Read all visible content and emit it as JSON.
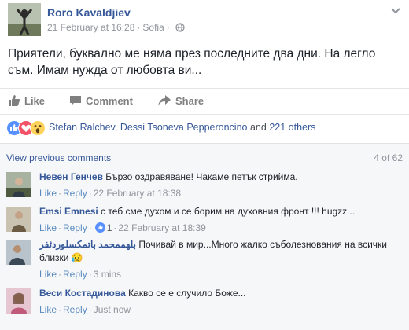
{
  "post": {
    "author": "Roro Kavaldjiev",
    "date": "21 February at 16:28",
    "location": "Sofia",
    "text": "Приятели, буквално ме няма през последните два дни. На легло съм. Имам нужда от любовта ви..."
  },
  "actions": {
    "like": "Like",
    "comment": "Comment",
    "share": "Share"
  },
  "reactions": {
    "icons": [
      "like",
      "love",
      "wow"
    ],
    "names": [
      "Stefan Ralchev",
      "Dessi Tsoneva Pepperoncino"
    ],
    "sep": ", ",
    "and_text": " and ",
    "others": "221 others"
  },
  "comments_header": {
    "view_previous": "View previous comments",
    "count": "4 of 62"
  },
  "comments": [
    {
      "author": "Невен Генчев",
      "text": "Бързо оздравяване! Чакаме петък стрийма.",
      "like": "Like",
      "reply": "Reply",
      "time": "22 February at 18:38",
      "reaction_count": ""
    },
    {
      "author": "Emsi Emnesi",
      "text": "с теб сме духом и се борим на духовния фронт !!! hugzz...",
      "like": "Like",
      "reply": "Reply",
      "time": "22 February at 18:39",
      "reaction_count": "1"
    },
    {
      "author": "بلهممحمد باتمكسلوردئفر",
      "text": "Почивай в мир...Много жалко съболезнования на всички близки 😥",
      "like": "Like",
      "reply": "Reply",
      "time": "3 mins",
      "reaction_count": ""
    },
    {
      "author": "Веси Костадинова",
      "text": "Какво се е случило Боже...",
      "like": "Like",
      "reply": "Reply",
      "time": "Just now",
      "reaction_count": ""
    }
  ],
  "colors": {
    "link": "#365899",
    "meta": "#90949c",
    "comments_bg": "#f6f7f9",
    "like_blue": "#5890ff"
  }
}
